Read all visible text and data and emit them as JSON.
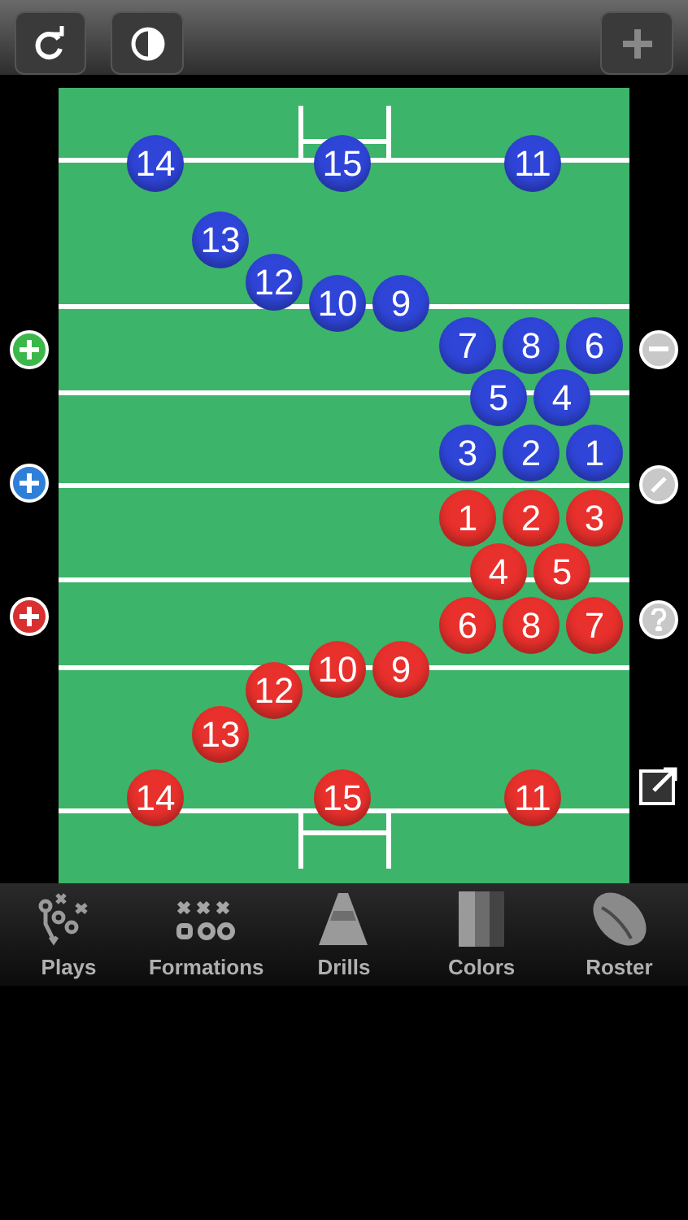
{
  "players": [
    {
      "number": "14",
      "color": "#2f45d8"
    },
    {
      "number": "15",
      "color": "#2f45d8"
    },
    {
      "number": "11",
      "color": "#2f45d8"
    },
    {
      "number": "13",
      "color": "#2f45d8"
    },
    {
      "number": "12",
      "color": "#2f45d8"
    },
    {
      "number": "10",
      "color": "#2f45d8"
    },
    {
      "number": "9",
      "color": "#2f45d8"
    },
    {
      "number": "7",
      "color": "#2f45d8"
    },
    {
      "number": "8",
      "color": "#2f45d8"
    },
    {
      "number": "6",
      "color": "#2f45d8"
    },
    {
      "number": "5",
      "color": "#2f45d8"
    },
    {
      "number": "4",
      "color": "#2f45d8"
    },
    {
      "number": "3",
      "color": "#2f45d8"
    },
    {
      "number": "2",
      "color": "#2f45d8"
    },
    {
      "number": "1",
      "color": "#2f45d8"
    },
    {
      "number": "1",
      "color": "#e8302c"
    },
    {
      "number": "2",
      "color": "#e8302c"
    },
    {
      "number": "3",
      "color": "#e8302c"
    },
    {
      "number": "4",
      "color": "#e8302c"
    },
    {
      "number": "5",
      "color": "#e8302c"
    },
    {
      "number": "6",
      "color": "#e8302c"
    },
    {
      "number": "8",
      "color": "#e8302c"
    },
    {
      "number": "7",
      "color": "#e8302c"
    },
    {
      "number": "10",
      "color": "#e8302c"
    },
    {
      "number": "9",
      "color": "#e8302c"
    },
    {
      "number": "12",
      "color": "#e8302c"
    },
    {
      "number": "13",
      "color": "#e8302c"
    },
    {
      "number": "14",
      "color": "#e8302c"
    },
    {
      "number": "15",
      "color": "#e8302c"
    },
    {
      "number": "11",
      "color": "#e8302c"
    }
  ],
  "add_buttons": [
    {
      "color": "#3cb84a"
    },
    {
      "color": "#2f7fd8"
    },
    {
      "color": "#d83030"
    }
  ],
  "tab_bar": [
    {
      "label": "Plays",
      "kind": "plays"
    },
    {
      "label": "Formations",
      "kind": "formations"
    },
    {
      "label": "Drills",
      "kind": "drills"
    },
    {
      "label": "Colors",
      "kind": "colors"
    },
    {
      "label": "Roster",
      "kind": "roster"
    }
  ]
}
